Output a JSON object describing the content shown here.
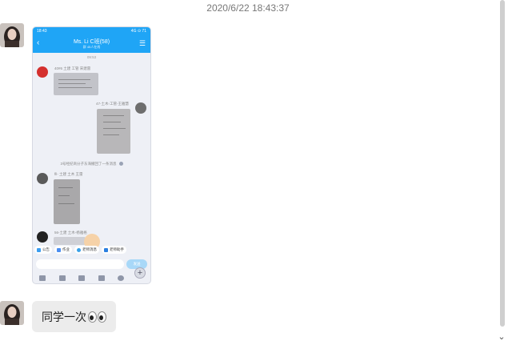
{
  "chat": {
    "timestamp": "2020/6/22 18:43:37"
  },
  "phone": {
    "status_time": "18:43",
    "status_right": "4G ⊙ 71",
    "title": "Ms. Li C班(58)",
    "subtitle": "群 45人在线",
    "time_label": "09:53",
    "messages": [
      {
        "name": "40#6 土建 工管 宋建雷"
      },
      {
        "name": "47-土木-工管-王雅慧"
      },
      {
        "name": "fll- 土建 土木 王雷"
      },
      {
        "name": "56-土建 土木-杨雅格"
      }
    ],
    "notice": "3号经纪商分子东海撤回了一条消息",
    "tools": [
      "公告",
      "作业",
      "老师消息",
      "老师助手"
    ],
    "send_label": "发送"
  },
  "bubble": {
    "text": "同学一次"
  },
  "colors": {
    "phone_header": "#1fa5f6",
    "bubble_bg": "#ececec"
  }
}
